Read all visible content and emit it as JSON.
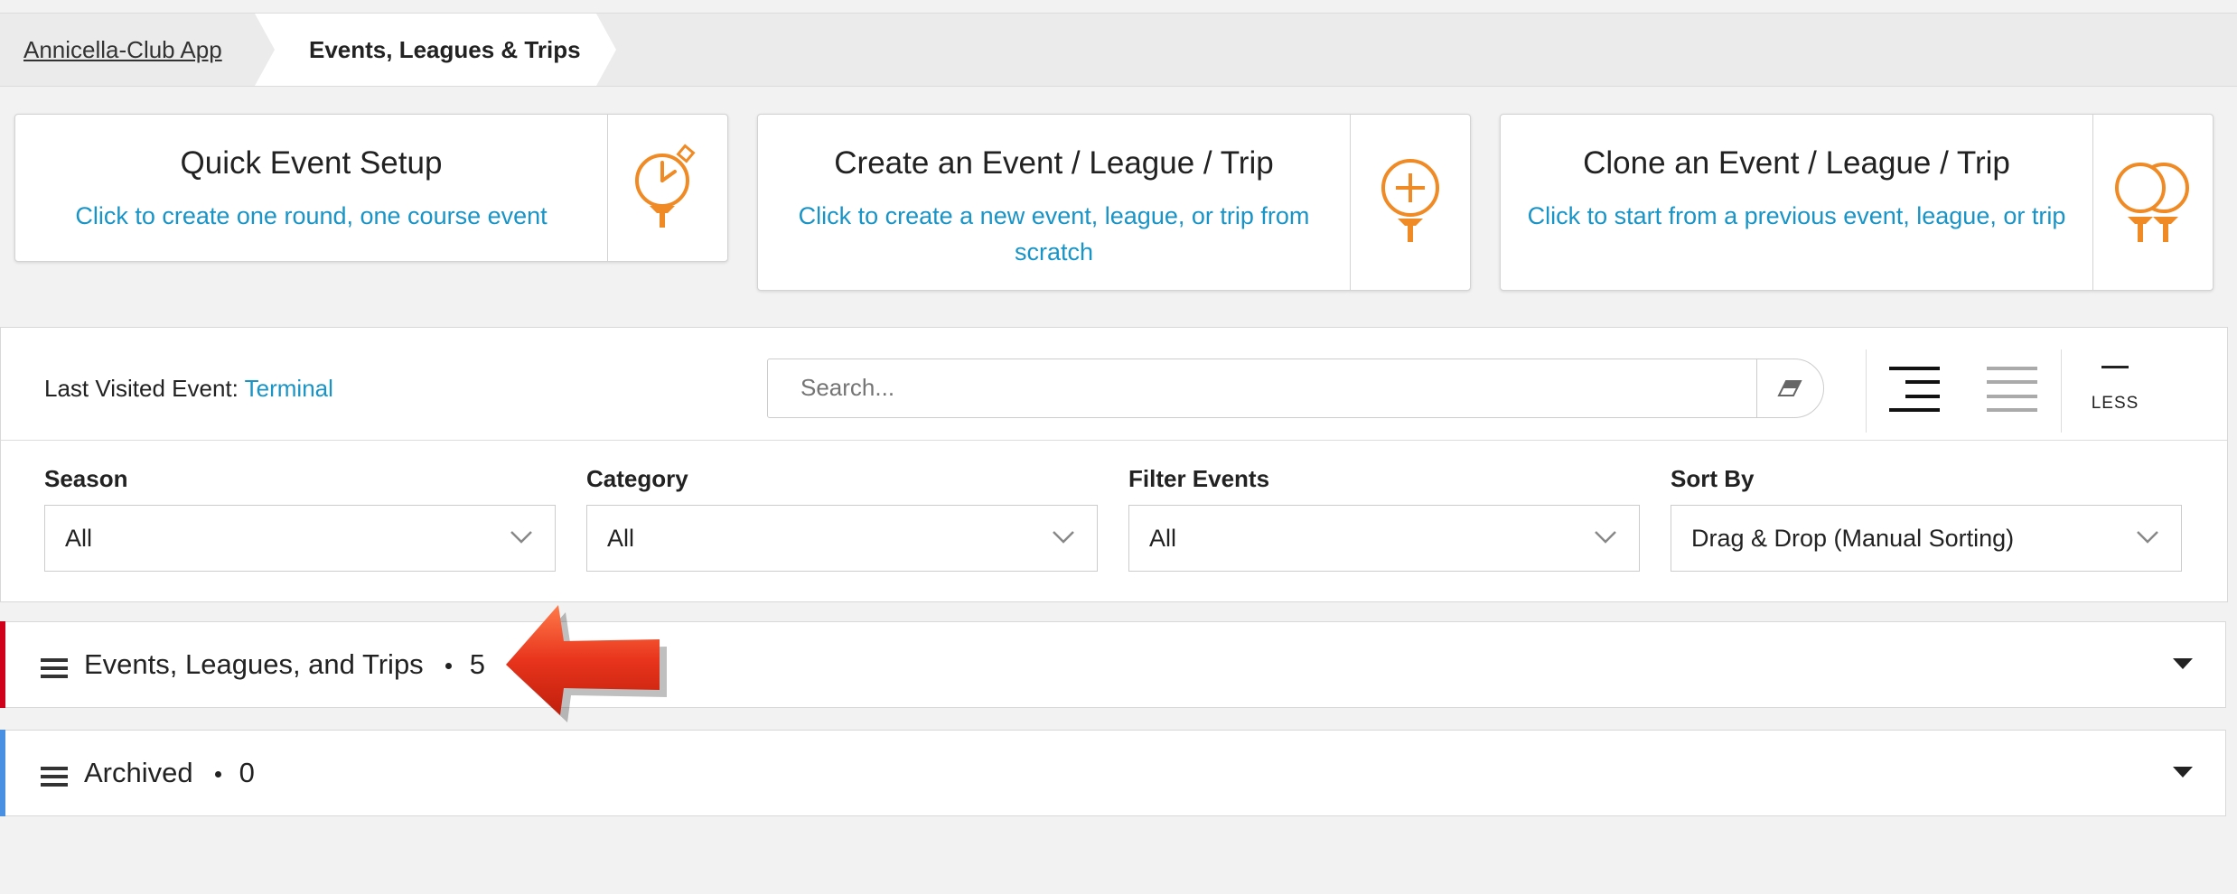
{
  "breadcrumb": {
    "home": "Annicella-Club App",
    "current": "Events, Leagues & Trips"
  },
  "cards": [
    {
      "title": "Quick Event Setup",
      "subtitle": "Click to create one round, one course event",
      "icon": "stopwatch-tee-icon"
    },
    {
      "title": "Create an Event / League / Trip",
      "subtitle": "Click to create a new event, league, or trip from scratch",
      "icon": "plus-tee-icon"
    },
    {
      "title": "Clone an Event / League / Trip",
      "subtitle": "Click to start from a previous event, league, or trip",
      "icon": "double-tee-icon"
    }
  ],
  "last_visited": {
    "label": "Last Visited Event:",
    "event": "Terminal"
  },
  "search": {
    "placeholder": "Search...",
    "value": ""
  },
  "view_controls": {
    "less_label": "LESS"
  },
  "filters": [
    {
      "label": "Season",
      "value": "All"
    },
    {
      "label": "Category",
      "value": "All"
    },
    {
      "label": "Filter Events",
      "value": "All"
    },
    {
      "label": "Sort By",
      "value": "Drag & Drop (Manual Sorting)"
    }
  ],
  "sections": [
    {
      "label": "Events, Leagues, and Trips",
      "count": "5",
      "accent": "#d0021b"
    },
    {
      "label": "Archived",
      "count": "0",
      "accent": "#4a90e2"
    }
  ],
  "colors": {
    "accent_orange": "#f08a24",
    "link_blue": "#1994c7",
    "arrow_red": "#e8341c"
  }
}
